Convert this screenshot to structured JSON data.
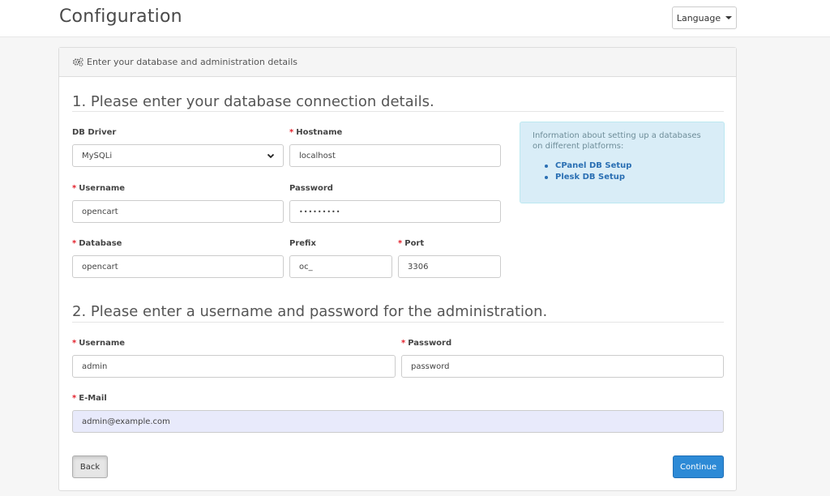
{
  "header": {
    "title": "Configuration",
    "language_label": "Language"
  },
  "panel": {
    "heading": "Enter your database and administration details",
    "heading_icon": "cogs-icon"
  },
  "db_section": {
    "title": "1. Please enter your database connection details.",
    "driver": {
      "label": "DB Driver",
      "value": "MySQLi",
      "required": false
    },
    "hostname": {
      "label": "Hostname",
      "value": "localhost",
      "required": true
    },
    "username": {
      "label": "Username",
      "value": "opencart",
      "required": true
    },
    "password": {
      "label": "Password",
      "value": "•••••••••",
      "required": false
    },
    "database": {
      "label": "Database",
      "value": "opencart",
      "required": true
    },
    "prefix": {
      "label": "Prefix",
      "value": "oc_",
      "required": false
    },
    "port": {
      "label": "Port",
      "value": "3306",
      "required": true
    }
  },
  "info": {
    "text": "Information about setting up a databases on different platforms:",
    "links": [
      "CPanel DB Setup",
      "Plesk DB Setup"
    ]
  },
  "admin_section": {
    "title": "2. Please enter a username and password for the administration.",
    "username": {
      "label": "Username",
      "value": "admin",
      "required": true
    },
    "password": {
      "label": "Password",
      "value": "password",
      "required": true
    },
    "email": {
      "label": "E-Mail",
      "value": "admin@example.com",
      "required": true
    }
  },
  "buttons": {
    "back": "Back",
    "continue": "Continue"
  },
  "colors": {
    "required": "#e3202b",
    "primary": "#2d8ad6",
    "info_bg": "#d9edf7",
    "link": "#2a6fb3"
  }
}
